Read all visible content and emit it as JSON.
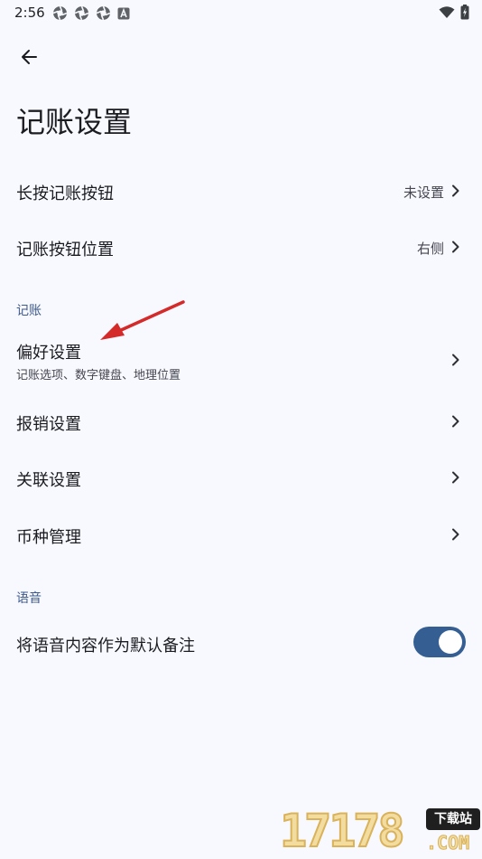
{
  "status_bar": {
    "time": "2:56",
    "left_icons": [
      "app-notification-icon",
      "app-notification-icon",
      "app-notification-icon",
      "font-a-icon"
    ],
    "right_icons": [
      "wifi-icon",
      "battery-icon"
    ]
  },
  "header": {
    "back_icon": "arrow-left-icon",
    "title": "记账设置"
  },
  "general_items": [
    {
      "label": "长按记账按钮",
      "value": "未设置"
    },
    {
      "label": "记账按钮位置",
      "value": "右侧"
    }
  ],
  "section_bookkeeping": {
    "title": "记账",
    "items": [
      {
        "label": "偏好设置",
        "subtitle": "记账选项、数字键盘、地理位置"
      },
      {
        "label": "报销设置"
      },
      {
        "label": "关联设置"
      },
      {
        "label": "币种管理"
      }
    ]
  },
  "section_voice": {
    "title": "语音",
    "items": [
      {
        "label": "将语音内容作为默认备注",
        "toggle_on": true
      }
    ]
  },
  "colors": {
    "background": "#f8f9ff",
    "section_header": "#3d5a8c",
    "toggle_on": "#355f93",
    "annotation_arrow": "#d42a2a"
  },
  "watermark": {
    "digits": "17178",
    "badge": "下载站",
    "domain": ".COM"
  }
}
